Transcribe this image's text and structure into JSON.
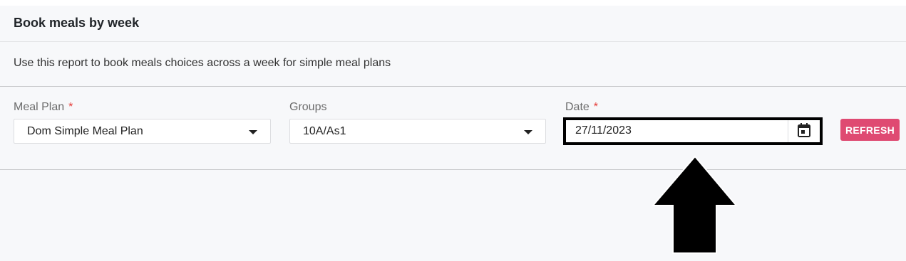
{
  "header": {
    "title": "Book meals by week"
  },
  "description": "Use this report to book meals choices across a week for simple meal plans",
  "filters": {
    "meal_plan": {
      "label": "Meal Plan",
      "required_marker": "*",
      "value": "Dom Simple Meal Plan"
    },
    "groups": {
      "label": "Groups",
      "value": "10A/As1"
    },
    "date": {
      "label": "Date",
      "required_marker": "*",
      "value": "27/11/2023"
    }
  },
  "actions": {
    "refresh_label": "REFRESH"
  },
  "colors": {
    "accent": "#df4a72",
    "required": "#e53935",
    "panel_bg": "#f7f8fa",
    "highlight": "#000000"
  },
  "icons": {
    "calendar": "calendar-icon",
    "dropdown": "caret-down-icon",
    "annotation": "up-arrow-annotation"
  }
}
